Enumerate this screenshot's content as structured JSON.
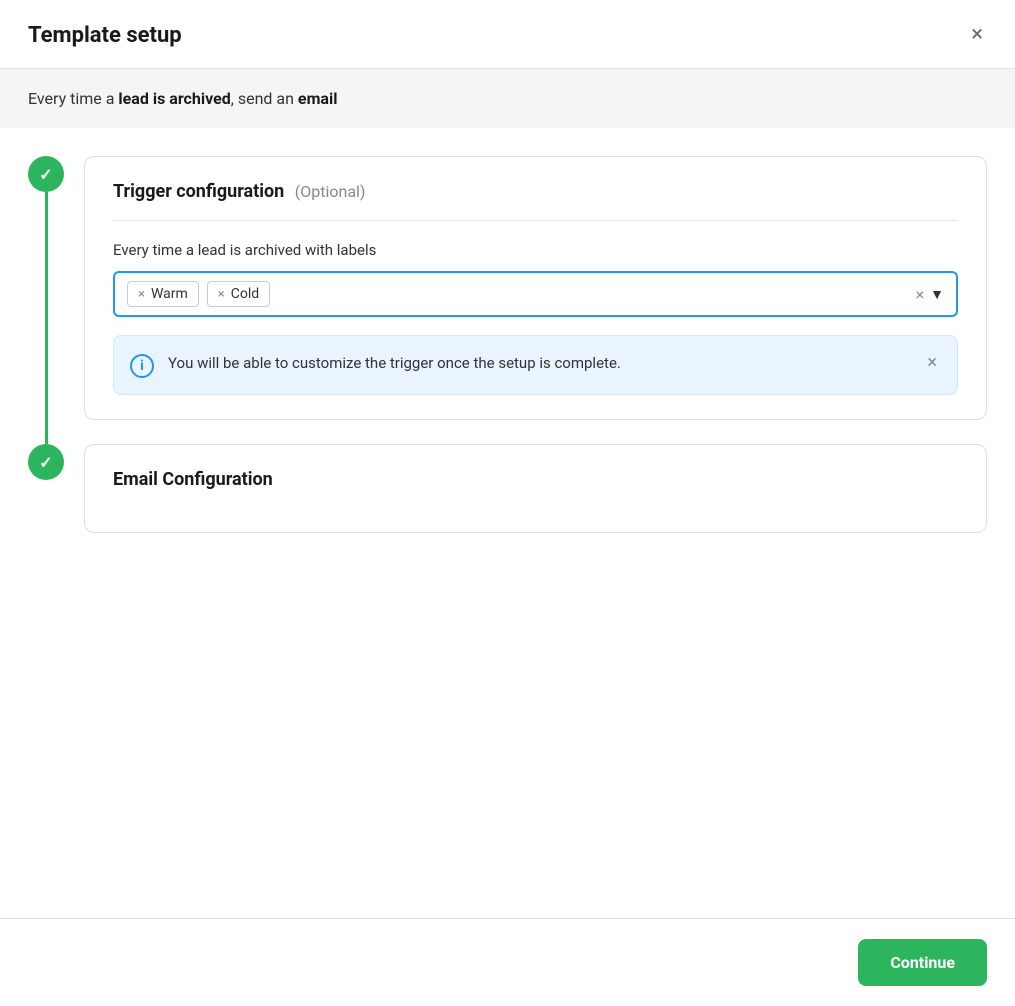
{
  "modal": {
    "title": "Template setup",
    "close_label": "×"
  },
  "description": {
    "prefix": "Every time a ",
    "bold1": "lead is archived",
    "middle": ", send an ",
    "bold2": "email"
  },
  "trigger_section": {
    "title": "Trigger configuration",
    "optional_label": "(Optional)",
    "trigger_label": "Every time a lead is archived with labels",
    "tags": [
      {
        "label": "Warm"
      },
      {
        "label": "Cold"
      }
    ],
    "clear_icon": "×",
    "dropdown_icon": "▼",
    "info_message": "You will be able to customize the trigger once the setup is complete.",
    "info_close": "×"
  },
  "email_section": {
    "title": "Email Configuration"
  },
  "footer": {
    "continue_label": "Continue"
  },
  "icons": {
    "checkmark": "✓",
    "info": "i"
  }
}
